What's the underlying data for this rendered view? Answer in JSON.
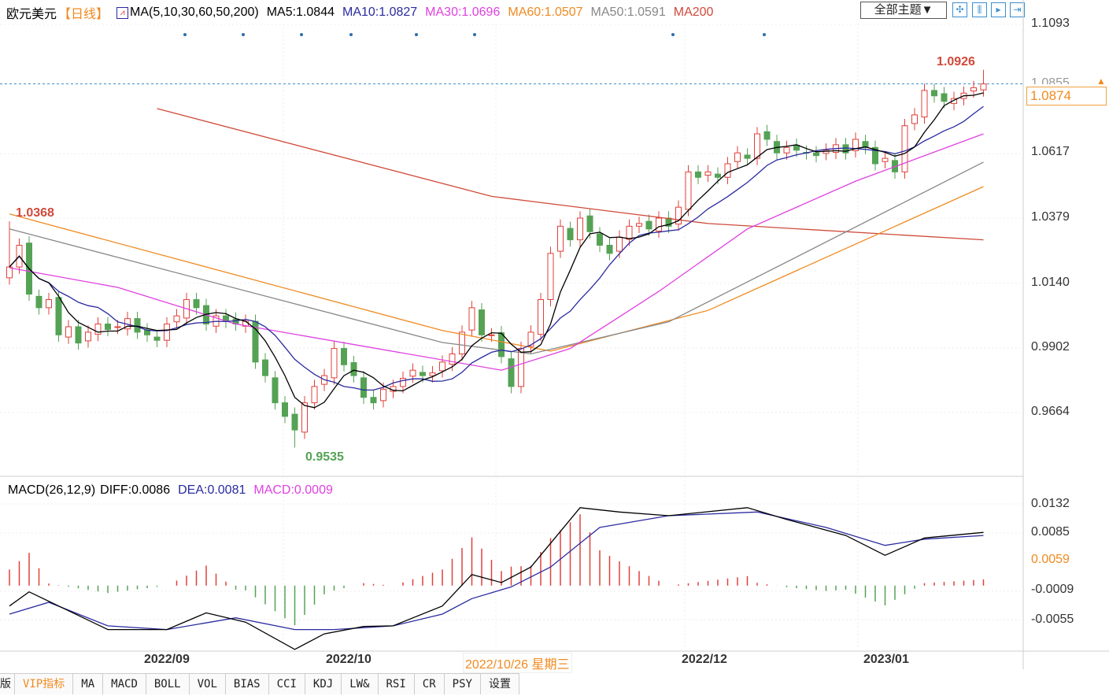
{
  "header": {
    "symbol": "欧元美元",
    "period": "【日线】",
    "ma_label": "MA(5,10,30,60,50,200)",
    "ma5": "MA5:1.0844",
    "ma10": "MA10:1.0827",
    "ma30": "MA30:1.0696",
    "ma60": "MA60:1.0507",
    "ma50": "MA50:1.0591",
    "ma200": "MA200",
    "theme_button": "全部主题▼"
  },
  "toolbar_icons": [
    "crosshair-icon",
    "zoom-in-icon",
    "step-icon",
    "exit-icon"
  ],
  "colors": {
    "up": "#e0403a",
    "down": "#55a255",
    "ma5": "#000000",
    "ma10": "#2a2aa0",
    "ma30": "#e040e0",
    "ma60": "#f08a20",
    "ma50": "#888888",
    "ma200": "#d04a3a",
    "diff": "#000000",
    "dea": "#2a2aa0",
    "current": "#3a8fd0"
  },
  "price_axis": {
    "ticks": [
      "1.1093",
      "1.0617",
      "1.0379",
      "1.0140",
      "0.9902",
      "0.9664"
    ],
    "current": "1.0874",
    "hidden_tick": "1.0855"
  },
  "annotations": {
    "high": "1.0926",
    "low": "0.9535",
    "left_high": "1.0368"
  },
  "macd": {
    "label": "MACD(26,12,9)",
    "diff": "DIFF:0.0086",
    "dea": "DEA:0.0081",
    "macd": "MACD:0.0009",
    "ticks": [
      "0.0132",
      "0.0085",
      "0.0059",
      "-0.0009",
      "-0.0055"
    ]
  },
  "date_axis": {
    "labels": [
      "2022/09",
      "2022/10",
      "2022/12",
      "2023/01"
    ],
    "crosshair": "2022/10/26 星期三"
  },
  "tabs": [
    "版",
    "VIP指标",
    "MA",
    "MACD",
    "BOLL",
    "VOL",
    "BIAS",
    "CCI",
    "KDJ",
    "LW&",
    "RSI",
    "CR",
    "PSY",
    "设置"
  ],
  "chart_data": {
    "type": "candlestick",
    "price_range": [
      0.948,
      1.1093
    ],
    "closes": [
      1.02,
      1.028,
      1.01,
      1.005,
      1.008,
      0.995,
      0.998,
      0.992,
      0.996,
      0.999,
      0.997,
      0.998,
      1.001,
      0.996,
      0.995,
      0.993,
      0.999,
      1.002,
      1.008,
      1.005,
      0.999,
      1.002,
      1.0,
      0.999,
      1.0,
      0.985,
      0.98,
      0.97,
      0.965,
      0.96,
      0.97,
      0.976,
      0.98,
      0.99,
      0.984,
      0.98,
      0.972,
      0.97,
      0.975,
      0.976,
      0.979,
      0.982,
      0.98,
      0.981,
      0.985,
      0.988,
      0.996,
      1.005,
      0.995,
      0.995,
      0.987,
      0.976,
      0.99,
      0.996,
      1.008,
      1.025,
      1.035,
      1.03,
      1.038,
      1.033,
      1.028,
      1.025,
      1.031,
      1.035,
      1.036,
      1.034,
      1.038,
      1.035,
      1.042,
      1.055,
      1.053,
      1.055,
      1.053,
      1.058,
      1.062,
      1.06,
      1.069,
      1.067,
      1.062,
      1.064,
      1.063,
      1.062,
      1.061,
      1.063,
      1.065,
      1.062,
      1.067,
      1.064,
      1.058,
      1.06,
      1.055,
      1.072,
      1.076,
      1.085,
      1.083,
      1.081,
      1.082,
      1.084,
      1.086,
      1.0874
    ],
    "extremes": {
      "high_index": 99,
      "high": 1.0926,
      "low_index": 29,
      "low": 0.9535,
      "left_high_index": 0,
      "left_high": 1.0368
    },
    "ma30": [
      [
        0,
        1.0197
      ],
      [
        11,
        1.0125
      ],
      [
        23,
        0.999
      ],
      [
        50,
        0.982
      ],
      [
        57,
        0.99
      ],
      [
        66,
        1.011
      ],
      [
        75,
        1.034
      ],
      [
        86,
        1.0516
      ],
      [
        99,
        1.069
      ]
    ],
    "ma50": [
      [
        0,
        1.034
      ],
      [
        44,
        0.9922
      ],
      [
        53,
        0.988
      ],
      [
        67,
        0.9998
      ],
      [
        99,
        1.0586
      ]
    ],
    "ma60": [
      [
        0,
        1.0395
      ],
      [
        44,
        0.9966
      ],
      [
        55,
        0.989
      ],
      [
        71,
        1.004
      ],
      [
        99,
        1.0496
      ]
    ],
    "ma200": [
      [
        15,
        1.0783
      ],
      [
        49,
        1.046
      ],
      [
        71,
        1.036
      ],
      [
        99,
        1.03
      ]
    ],
    "diff": [
      [
        0,
        -0.0033
      ],
      [
        2,
        -0.001
      ],
      [
        5,
        -0.0033
      ],
      [
        10,
        -0.0071
      ],
      [
        16,
        -0.0071
      ],
      [
        20,
        -0.0044
      ],
      [
        24,
        -0.0059
      ],
      [
        29,
        -0.0103
      ],
      [
        32,
        -0.0078
      ],
      [
        36,
        -0.0066
      ],
      [
        39,
        -0.0065
      ],
      [
        44,
        -0.0033
      ],
      [
        47,
        0.0018
      ],
      [
        50,
        0.0005
      ],
      [
        53,
        0.003
      ],
      [
        58,
        0.0126
      ],
      [
        62,
        0.0119
      ],
      [
        67,
        0.0113
      ],
      [
        75,
        0.0126
      ],
      [
        79,
        0.0107
      ],
      [
        85,
        0.0081
      ],
      [
        89,
        0.0049
      ],
      [
        93,
        0.0077
      ],
      [
        99,
        0.0086
      ]
    ],
    "dea": [
      [
        0,
        -0.0046
      ],
      [
        4,
        -0.0027
      ],
      [
        10,
        -0.0065
      ],
      [
        16,
        -0.0071
      ],
      [
        23,
        -0.0052
      ],
      [
        29,
        -0.0071
      ],
      [
        33,
        -0.0071
      ],
      [
        39,
        -0.0065
      ],
      [
        44,
        -0.0046
      ],
      [
        47,
        -0.0021
      ],
      [
        51,
        -0.0002
      ],
      [
        55,
        0.003
      ],
      [
        60,
        0.0094
      ],
      [
        67,
        0.0113
      ],
      [
        76,
        0.0119
      ],
      [
        83,
        0.0094
      ],
      [
        89,
        0.0065
      ],
      [
        93,
        0.0075
      ],
      [
        99,
        0.0081
      ]
    ],
    "macd_range": [
      -0.011,
      0.0132
    ]
  }
}
